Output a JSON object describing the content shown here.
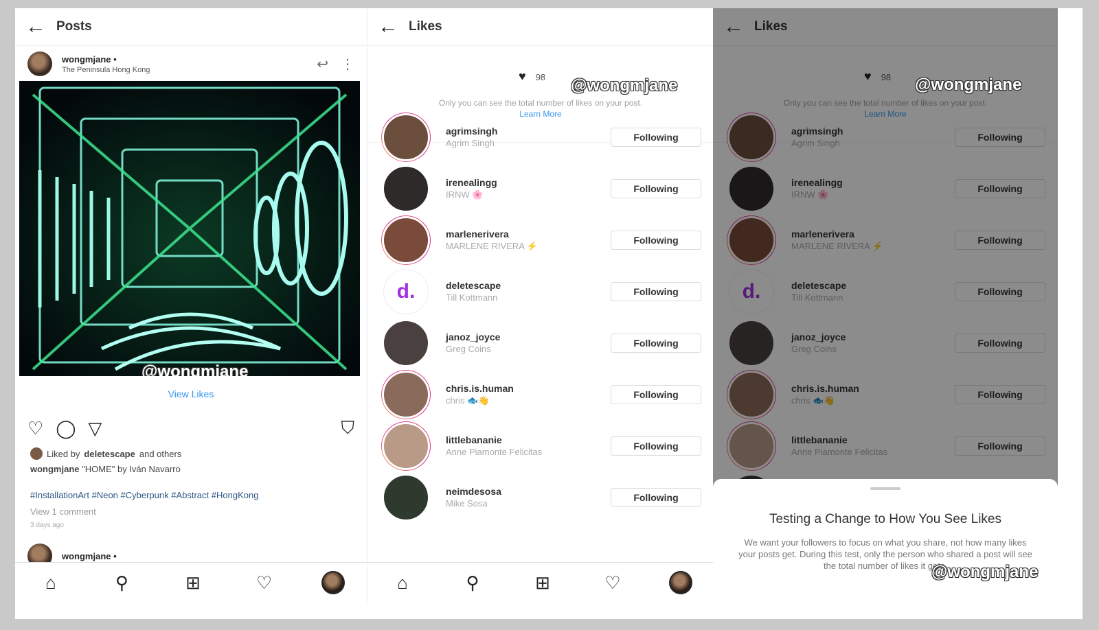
{
  "posts_panel": {
    "header_title": "Posts",
    "post": {
      "username": "wongmjane •",
      "location": "The Peninsula Hong Kong",
      "view_likes": "View Likes",
      "liked_by_prefix": "Liked by",
      "liked_by_user": "deletescape",
      "liked_by_suffix": "and others",
      "caption_user": "wongmjane",
      "caption_text": "\"HOME\" by Iván Navarro",
      "hashtags": "#InstallationArt #Neon #Cyberpunk #Abstract #HongKong",
      "comments": "View 1 comment",
      "time_ago": "3 days ago"
    },
    "next_post_user": "wongmjane •"
  },
  "likes_panel": {
    "header_title": "Likes",
    "like_count": "98",
    "private_note": "Only you can see the total number of likes on your post.",
    "learn_more": "Learn More",
    "watermark": "@wongmjane",
    "follow_label": "Following",
    "users": [
      {
        "username": "agrimsingh",
        "fullname": "Agrim Singh",
        "ring": "story",
        "avatar": "#6b4e3c"
      },
      {
        "username": "irenealingg",
        "fullname": "IRNW 🌸",
        "ring": "plain",
        "avatar": "#2f2a2a"
      },
      {
        "username": "marlenerivera",
        "fullname": "MARLENE RIVERA ⚡",
        "ring": "story",
        "avatar": "#7a4a3a"
      },
      {
        "username": "deletescape",
        "fullname": "Till Kottmann",
        "ring": "plain",
        "avatar": "#ffffff"
      },
      {
        "username": "janoz_joyce",
        "fullname": "Greg Coins",
        "ring": "plain",
        "avatar": "#4a4040"
      },
      {
        "username": "chris.is.human",
        "fullname": "chris 🐟👋",
        "ring": "story",
        "avatar": "#8a6a5a"
      },
      {
        "username": "littlebananie",
        "fullname": "Anne Piamonte Felicitas",
        "ring": "story",
        "avatar": "#b89a86"
      },
      {
        "username": "neimdesosa",
        "fullname": "Mike Sosa",
        "ring": "plain",
        "avatar": "#2e3a2e"
      }
    ]
  },
  "likes_dimmed_panel": {
    "header_title": "Likes",
    "like_count": "98",
    "private_note": "Only you can see the total number of likes on your post.",
    "learn_more": "Learn More",
    "watermark": "@wongmjane",
    "follow_label": "Following",
    "sheet_title": "Testing a Change to How You See Likes",
    "sheet_body": "We want your followers to focus on what you share, not how many likes your posts get. During this test, only the person who shared a post will see the total number of likes it gets.",
    "sheet_watermark": "@wongmjane"
  },
  "photo_watermark": "@wongmjane",
  "deletescape_logo": "d.",
  "colors": {
    "link": "#3897f0",
    "story_ring": "#d6249f",
    "photo_neon": "#27e0a6"
  }
}
